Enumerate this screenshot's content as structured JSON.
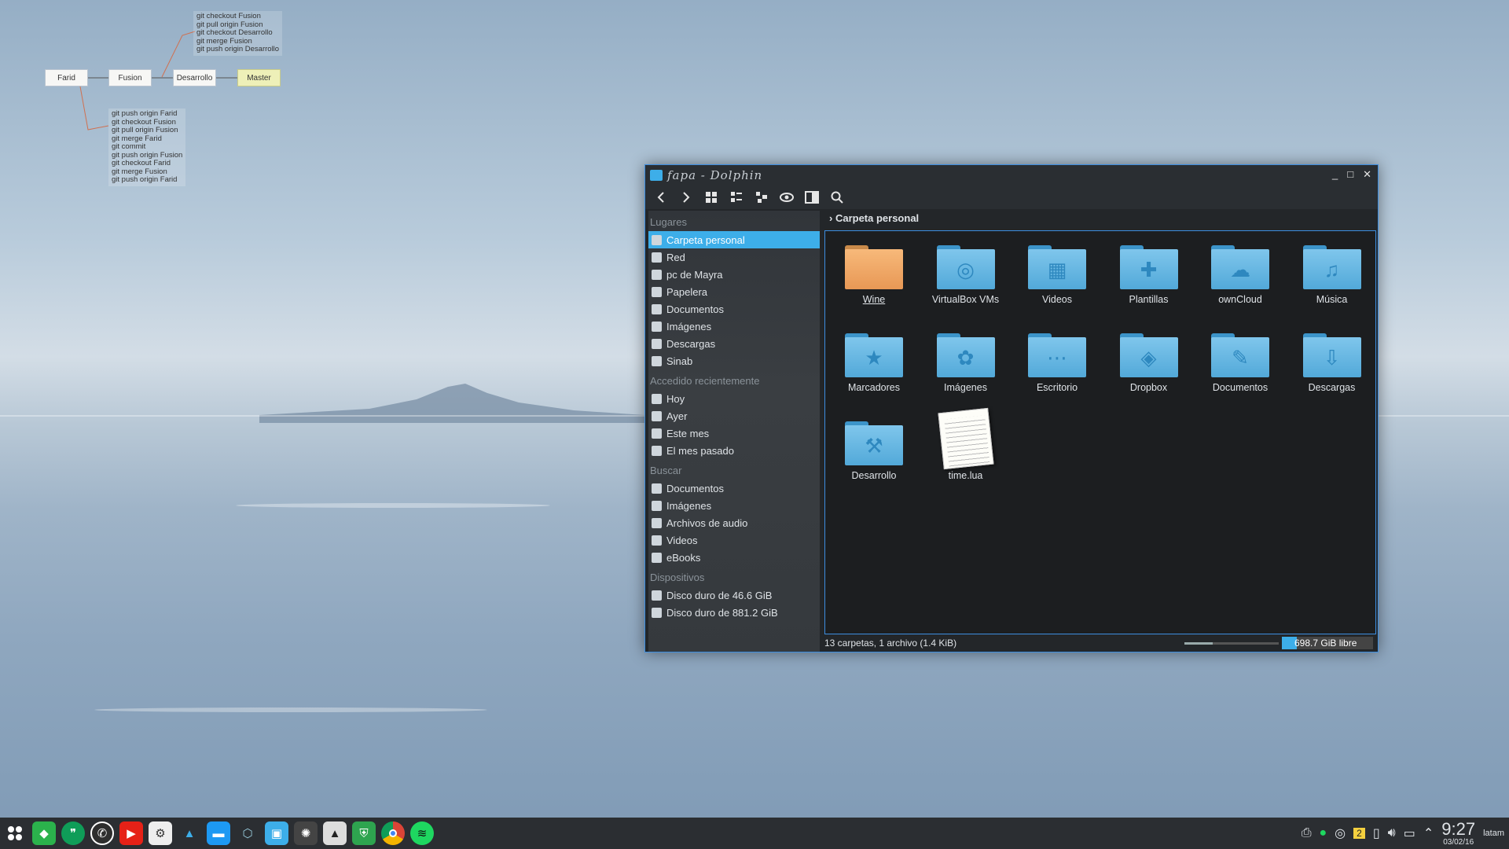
{
  "git_diagram": {
    "nodes": [
      "Farid",
      "Fusion",
      "Desarrollo",
      "Master"
    ],
    "top_commands": [
      "git checkout Fusion",
      "git pull origin Fusion",
      "git checkout Desarrollo",
      "git merge Fusion",
      "git push origin Desarrollo"
    ],
    "bottom_commands": [
      "git push origin Farid",
      "git checkout Fusion",
      "git pull origin Fusion",
      "git merge Farid",
      "git commit",
      "git push origin Fusion",
      "git checkout Farid",
      "git merge Fusion",
      "git push origin Farid"
    ]
  },
  "window": {
    "title": "fapa - Dolphin",
    "breadcrumb": "Carpeta personal",
    "sidebar": {
      "places_header": "Lugares",
      "places": [
        "Carpeta personal",
        "Red",
        "pc de Mayra",
        "Papelera",
        "Documentos",
        "Imágenes",
        "Descargas",
        "Sinab"
      ],
      "recent_header": "Accedido recientemente",
      "recent": [
        "Hoy",
        "Ayer",
        "Este mes",
        "El mes pasado"
      ],
      "search_header": "Buscar",
      "search": [
        "Documentos",
        "Imágenes",
        "Archivos de audio",
        "Videos",
        "eBooks"
      ],
      "devices_header": "Dispositivos",
      "devices": [
        "Disco duro de 46.6 GiB",
        "Disco duro de 881.2 GiB"
      ]
    },
    "files": [
      {
        "name": "Wine",
        "icon": "wine-folder-icon"
      },
      {
        "name": "VirtualBox VMs",
        "icon": "virtualbox-folder-icon"
      },
      {
        "name": "Videos",
        "icon": "videos-folder-icon"
      },
      {
        "name": "Plantillas",
        "icon": "templates-folder-icon"
      },
      {
        "name": "ownCloud",
        "icon": "owncloud-folder-icon"
      },
      {
        "name": "Música",
        "icon": "music-folder-icon"
      },
      {
        "name": "Marcadores",
        "icon": "bookmarks-folder-icon"
      },
      {
        "name": "Imágenes",
        "icon": "pictures-folder-icon"
      },
      {
        "name": "Escritorio",
        "icon": "desktop-folder-icon"
      },
      {
        "name": "Dropbox",
        "icon": "dropbox-folder-icon"
      },
      {
        "name": "Documentos",
        "icon": "documents-folder-icon"
      },
      {
        "name": "Descargas",
        "icon": "downloads-folder-icon"
      },
      {
        "name": "Desarrollo",
        "icon": "development-folder-icon"
      },
      {
        "name": "time.lua",
        "icon": "text-file-icon"
      }
    ],
    "status_text": "13 carpetas, 1 archivo (1.4 KiB)",
    "free_space": "698.7 GiB libre",
    "disk_used_fraction": 0.16
  },
  "taskbar": {
    "clock_time": "9:27",
    "clock_date": "03/02/16",
    "tray_badge": "2",
    "tray_user": "latam"
  },
  "colors": {
    "accent": "#3daee9",
    "folder": "#6bbbe6",
    "wine_folder": "#f2ae6a"
  }
}
